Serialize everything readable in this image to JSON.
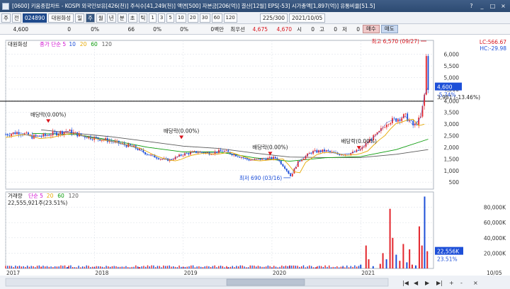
{
  "window": {
    "title": "[0600] 키움종합차트 - KOSPI 외국인보유[426(천)] 주식수[41,249(천)] 액면[500] 자본금[206(억)] 결산[12월] EPS[-53] 시가총액[1,897(억)] 유통비율[51.5]",
    "controls": [
      "?",
      "_",
      "□",
      "×"
    ]
  },
  "toolbar": {
    "kind": "주",
    "mode": "전",
    "code": "024890",
    "name": "대원화성",
    "periods": [
      "일",
      "주",
      "월",
      "년",
      "분",
      "초",
      "틱"
    ],
    "active_period": "주",
    "intervals": [
      "1",
      "3",
      "5",
      "10",
      "20",
      "30",
      "60",
      "120"
    ],
    "count": "225/300",
    "date": "2021/10/05"
  },
  "quote": {
    "price": "4,600",
    "change": "0",
    "change_pct": "0%",
    "volume": "66",
    "vol_pct": "0%",
    "amt_pct": "0%",
    "amount": "0백만",
    "priority_label": "최우선",
    "ask": "4,675",
    "bid": "4,670",
    "open_label": "시",
    "open": "0",
    "high_label": "고",
    "high": "0",
    "low_label": "저",
    "low": "0",
    "buy_label": "매수",
    "sell_label": "매도"
  },
  "chart_data": [
    {
      "type": "line",
      "title": "대원화성",
      "legend": [
        "종가 단순 5",
        "10",
        "20",
        "60",
        "120"
      ],
      "legend_colors": [
        "#d10fd1",
        "#1d4fd8",
        "#e6a800",
        "#0a9b0a",
        "#5a5a5a"
      ],
      "lc": "LC:566.67",
      "hc": "HC:-29.98",
      "yticks": [
        500,
        1000,
        1500,
        2000,
        2500,
        3000,
        3500,
        4000,
        4500,
        5000,
        5500,
        6000
      ],
      "ylabels": [
        "500",
        "1,000",
        "1,500",
        "2,000",
        "2,500",
        "3,000",
        "3,500",
        "4,000",
        "4,500",
        "5,000",
        "5,500",
        "6,000"
      ],
      "ylim": [
        200,
        6600
      ],
      "current_price": "4,600",
      "current_change": "-5.74%",
      "hline_label": "3,981 (-13.46%)",
      "hline_value": 3981,
      "annotations": [
        {
          "text": "최고 6,570 (09/27)",
          "x": 2021.74,
          "y": 6570
        },
        {
          "text": "최저 690 (03/16)",
          "x": 2020.21,
          "y": 690
        },
        {
          "text": "배당락(0.00%)",
          "x": 2017.48,
          "y": 2900
        },
        {
          "text": "배당락(0.00%)",
          "x": 2018.98,
          "y": 2200
        },
        {
          "text": "배당락(0.00%)",
          "x": 2019.98,
          "y": 1500
        },
        {
          "text": "배당락(0.00%)",
          "x": 2020.98,
          "y": 1750
        }
      ],
      "close": [
        [
          2017.0,
          2550
        ],
        [
          2017.15,
          2650
        ],
        [
          2017.3,
          2450
        ],
        [
          2017.45,
          2500
        ],
        [
          2017.55,
          2600
        ],
        [
          2017.7,
          2700
        ],
        [
          2017.85,
          2500
        ],
        [
          2018.0,
          2400
        ],
        [
          2018.15,
          2300
        ],
        [
          2018.3,
          2150
        ],
        [
          2018.45,
          2000
        ],
        [
          2018.6,
          1700
        ],
        [
          2018.75,
          1500
        ],
        [
          2018.85,
          1450
        ],
        [
          2019.0,
          1700
        ],
        [
          2019.15,
          1800
        ],
        [
          2019.3,
          1750
        ],
        [
          2019.45,
          1850
        ],
        [
          2019.6,
          1650
        ],
        [
          2019.75,
          1450
        ],
        [
          2019.9,
          1500
        ],
        [
          2020.05,
          1550
        ],
        [
          2020.15,
          1100
        ],
        [
          2020.21,
          750
        ],
        [
          2020.3,
          1400
        ],
        [
          2020.45,
          1800
        ],
        [
          2020.6,
          1850
        ],
        [
          2020.75,
          1700
        ],
        [
          2020.9,
          1750
        ],
        [
          2021.0,
          1900
        ],
        [
          2021.1,
          2300
        ],
        [
          2021.2,
          2600
        ],
        [
          2021.3,
          3100
        ],
        [
          2021.4,
          3200
        ],
        [
          2021.5,
          3350
        ],
        [
          2021.6,
          2900
        ],
        [
          2021.68,
          3300
        ],
        [
          2021.72,
          4300
        ],
        [
          2021.74,
          6000
        ],
        [
          2021.76,
          4600
        ]
      ],
      "ma120": [
        [
          2017.4,
          2750
        ],
        [
          2017.8,
          2600
        ],
        [
          2018.2,
          2450
        ],
        [
          2018.6,
          2250
        ],
        [
          2019.0,
          2050
        ],
        [
          2019.4,
          1950
        ],
        [
          2019.8,
          1750
        ],
        [
          2020.2,
          1580
        ],
        [
          2020.6,
          1560
        ],
        [
          2021.0,
          1560
        ],
        [
          2021.4,
          1700
        ],
        [
          2021.76,
          1900
        ]
      ],
      "ma60": [
        [
          2017.3,
          2600
        ],
        [
          2017.8,
          2550
        ],
        [
          2018.2,
          2300
        ],
        [
          2018.6,
          2000
        ],
        [
          2019.0,
          1800
        ],
        [
          2019.4,
          1800
        ],
        [
          2019.8,
          1550
        ],
        [
          2020.2,
          1400
        ],
        [
          2020.6,
          1550
        ],
        [
          2021.0,
          1600
        ],
        [
          2021.4,
          1900
        ],
        [
          2021.76,
          2350
        ]
      ]
    },
    {
      "type": "bar",
      "title": "거래량",
      "legend": [
        "단순 5",
        "20",
        "60",
        "120"
      ],
      "legend_colors": [
        "#d10fd1",
        "#e6a800",
        "#0a9b0a",
        "#5a5a5a"
      ],
      "value_label": "22,555,921주(23.51%)",
      "yticks": [
        20000000,
        40000000,
        60000000,
        80000000
      ],
      "ylabels": [
        "20,000K",
        "40,000K",
        "60,000K",
        "80,000K"
      ],
      "ylim": [
        0,
        100000000
      ],
      "current_label": "22,556K",
      "current_pct": "23.51%",
      "bars": [
        [
          2017.4,
          1500000
        ],
        [
          2017.7,
          1800000
        ],
        [
          2018.0,
          1200000
        ],
        [
          2018.5,
          1500000
        ],
        [
          2019.0,
          2000000
        ],
        [
          2019.5,
          1200000
        ],
        [
          2020.0,
          1000000
        ],
        [
          2020.2,
          3500000
        ],
        [
          2020.5,
          1500000
        ],
        [
          2020.8,
          2000000
        ],
        [
          2021.0,
          5000000
        ],
        [
          2021.06,
          30000000
        ],
        [
          2021.09,
          12000000
        ],
        [
          2021.14,
          3000000
        ],
        [
          2021.22,
          6000000
        ],
        [
          2021.25,
          20000000
        ],
        [
          2021.29,
          12000000
        ],
        [
          2021.33,
          78000000
        ],
        [
          2021.36,
          40000000
        ],
        [
          2021.4,
          18000000
        ],
        [
          2021.44,
          10000000
        ],
        [
          2021.48,
          32000000
        ],
        [
          2021.52,
          8000000
        ],
        [
          2021.55,
          25000000
        ],
        [
          2021.58,
          5000000
        ],
        [
          2021.62,
          4000000
        ],
        [
          2021.66,
          55000000
        ],
        [
          2021.69,
          30000000
        ],
        [
          2021.72,
          94000000
        ],
        [
          2021.75,
          22556000
        ]
      ]
    }
  ],
  "xaxis": {
    "labels": [
      "2017",
      "2018",
      "2019",
      "2020",
      "2021",
      "10/05"
    ],
    "positions": [
      2017.0,
      2018.0,
      2019.0,
      2020.0,
      2021.0,
      2021.76
    ],
    "xlim": [
      2017.0,
      2021.82
    ]
  },
  "scrollbar": {
    "buttons": [
      "|◀",
      "◀",
      "▶",
      "▶|",
      "+",
      "-",
      "×"
    ]
  }
}
